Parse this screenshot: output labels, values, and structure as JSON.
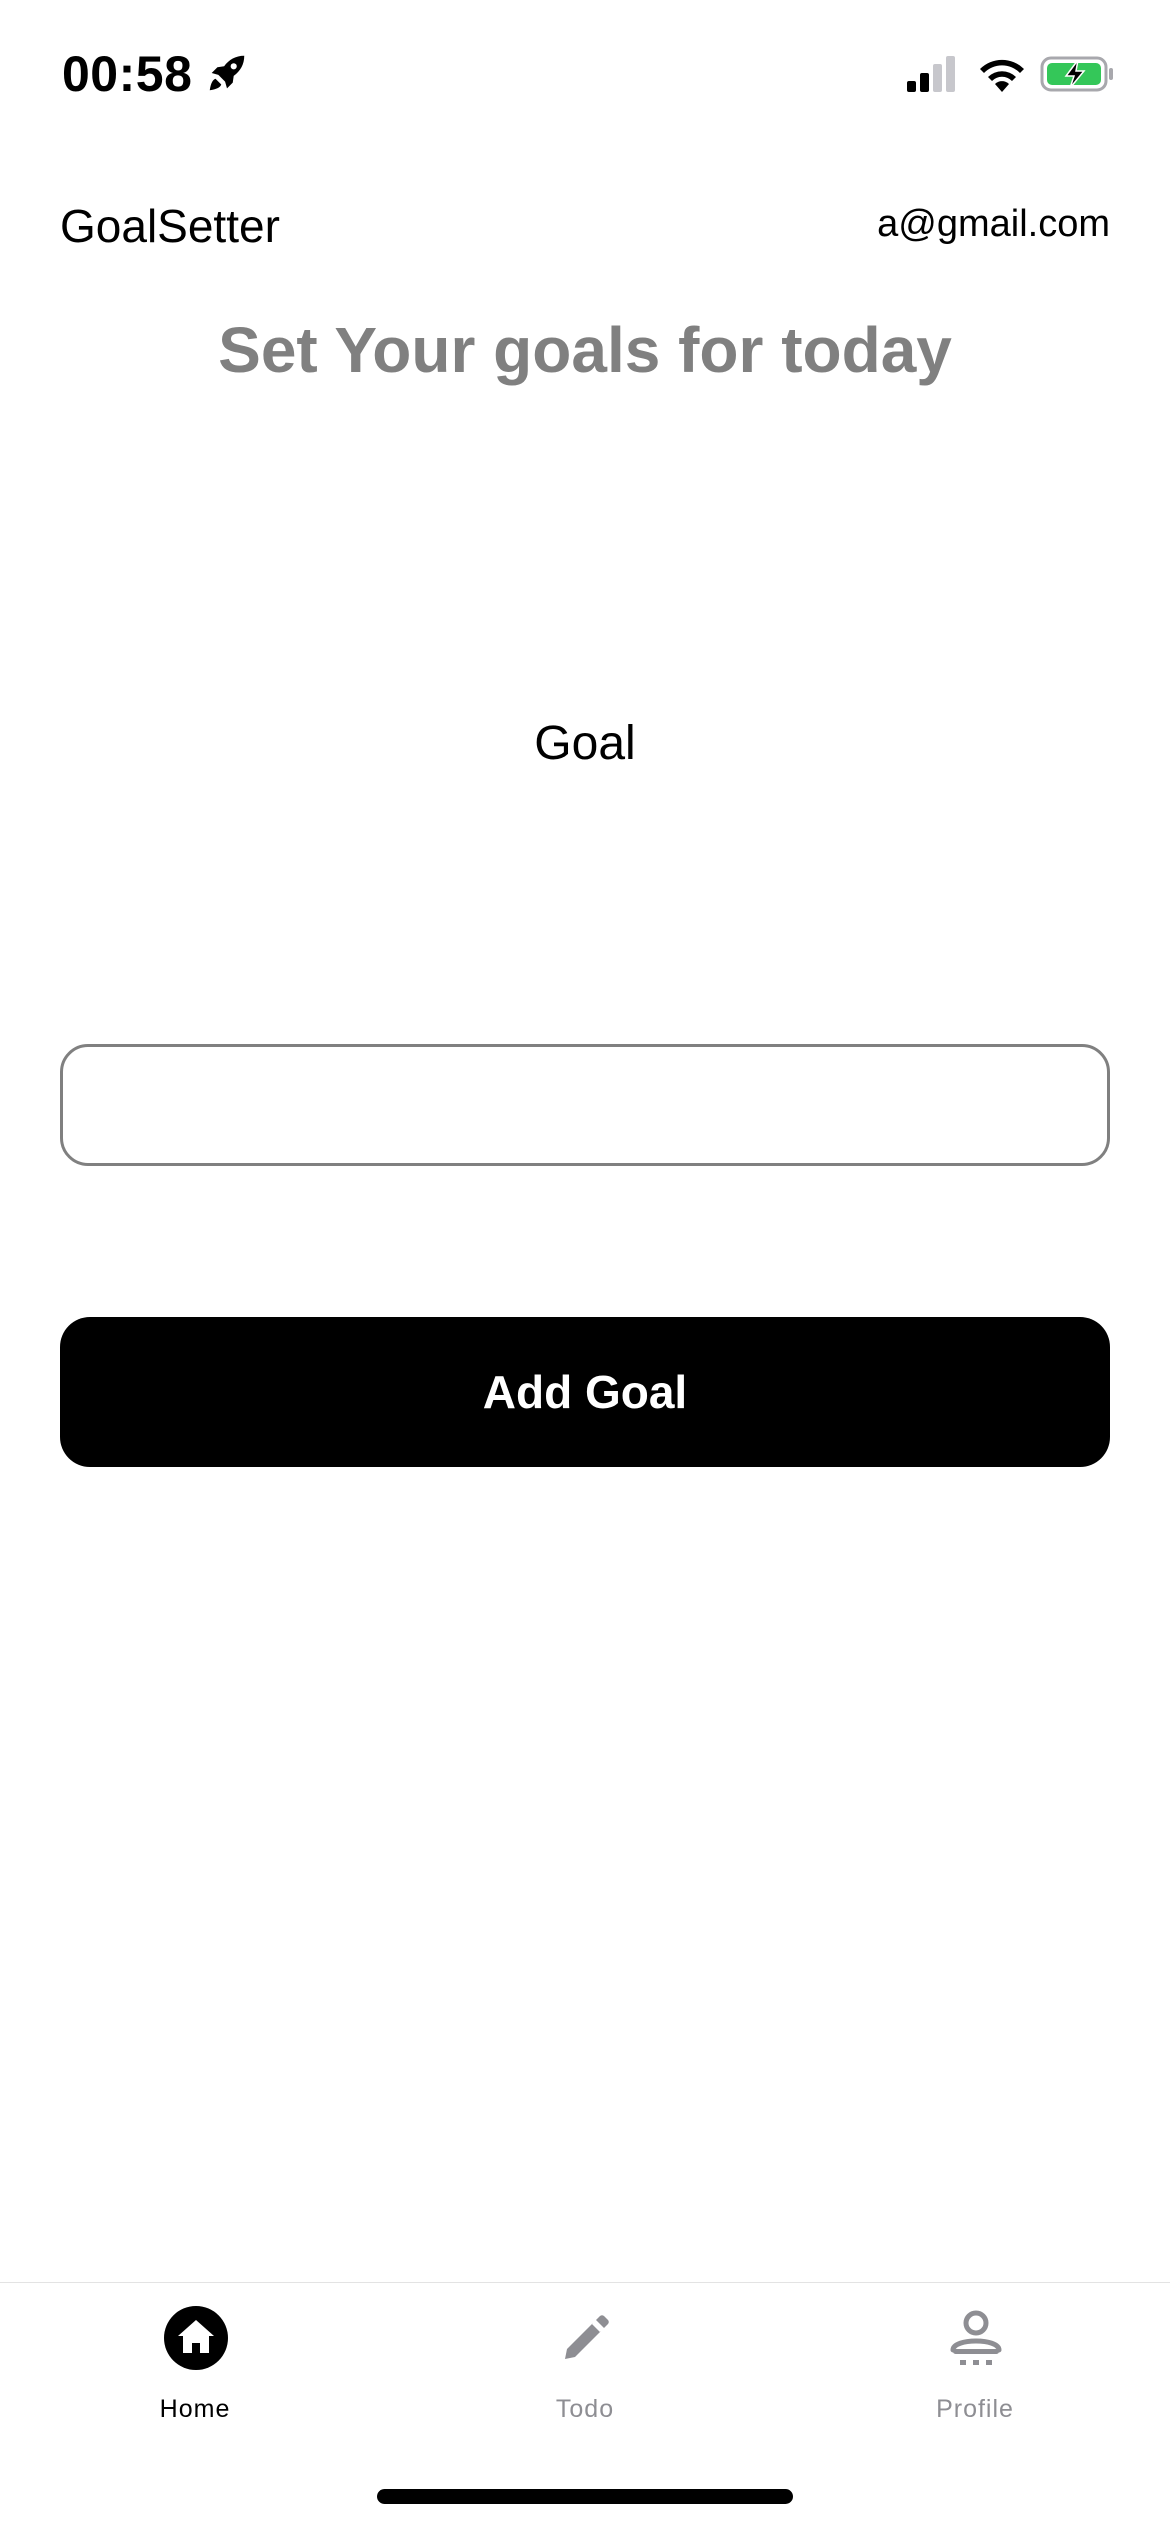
{
  "status_bar": {
    "time": "00:58",
    "icons": [
      "rocket-icon",
      "signal-icon",
      "wifi-icon",
      "battery-charging-icon"
    ],
    "battery_color": "#34c759"
  },
  "header": {
    "app_title": "GoalSetter",
    "user_email": "a@gmail.com"
  },
  "main": {
    "heading": "Set Your goals for today",
    "heading_color": "#808080",
    "goal_label": "Goal",
    "goal_input_value": "",
    "add_button_label": "Add Goal"
  },
  "tab_bar": {
    "active": "Home",
    "tabs": [
      {
        "label": "Home",
        "icon": "home-icon"
      },
      {
        "label": "Todo",
        "icon": "pencil-icon"
      },
      {
        "label": "Profile",
        "icon": "person-icon"
      }
    ]
  }
}
